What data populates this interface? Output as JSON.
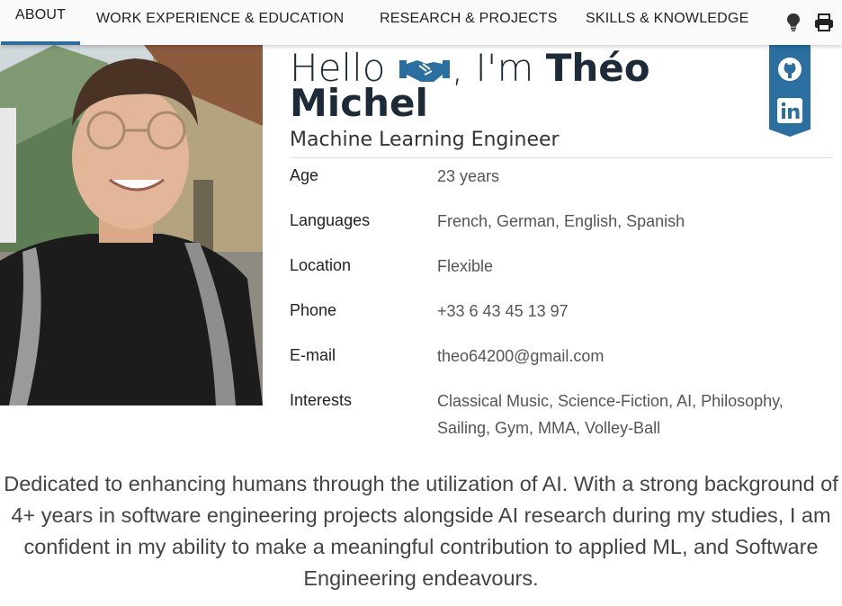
{
  "nav": {
    "tabs": [
      {
        "label": "ABOUT"
      },
      {
        "label": "WORK EXPERIENCE & EDUCATION"
      },
      {
        "label": "RESEARCH & PROJECTS"
      },
      {
        "label": "SKILLS & KNOWLEDGE"
      }
    ],
    "icons": [
      "lightbulb-icon",
      "print-icon"
    ]
  },
  "profile": {
    "hello_prefix": "Hello",
    "hello_suffix": ", I'm",
    "first_name": "Théo",
    "last_name": "Michel",
    "title": "Machine Learning Engineer"
  },
  "info": [
    {
      "key": "Age",
      "value": "23 years"
    },
    {
      "key": "Languages",
      "value": "French, German, English, Spanish"
    },
    {
      "key": "Location",
      "value": "Flexible"
    },
    {
      "key": "Phone",
      "value": "+33 6 43 45 13 97"
    },
    {
      "key": "E-mail",
      "value": "theo64200@gmail.com"
    },
    {
      "key": "Interests",
      "value": "Classical Music, Science-Fiction, AI, Philosophy, Sailing, Gym, MMA, Volley-Ball"
    }
  ],
  "social": [
    "github-icon",
    "linkedin-icon"
  ],
  "summary": "Dedicated to enhancing humans through the utilization of AI. With a strong background of 4+ years in software engineering projects alongside AI research during my studies, I am confident in my ability to make a meaningful contribution to applied ML, and Software Engineering endeavours.",
  "colors": {
    "accent": "#2a6fa0",
    "heading": "#1d2b38"
  }
}
